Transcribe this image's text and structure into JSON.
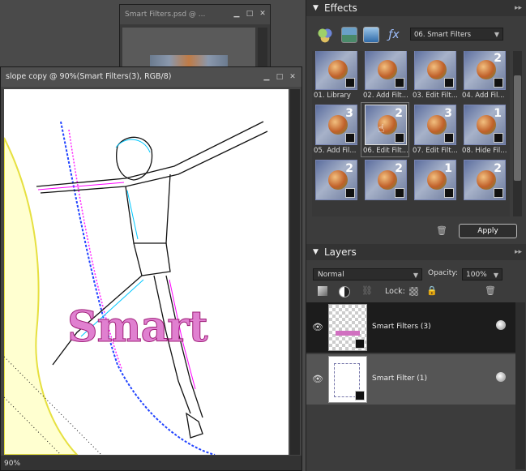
{
  "back_window": {
    "title": "Smart Filters.psd @ ..."
  },
  "doc_window": {
    "title": "slope copy @ 90%(Smart Filters(3), RGB/8)",
    "zoom": "90%",
    "canvas_text": "Smart"
  },
  "effects_panel": {
    "title": "Effects",
    "category_dropdown": "06. Smart Filters",
    "items": [
      {
        "label": "01. Library",
        "num": ""
      },
      {
        "label": "02. Add Filt...",
        "num": ""
      },
      {
        "label": "03. Edit Filt...",
        "num": ""
      },
      {
        "label": "04. Add Fil...",
        "num": "2"
      },
      {
        "label": "05. Add Fil...",
        "num": "3"
      },
      {
        "label": "06. Edit Filt...",
        "num": "2"
      },
      {
        "label": "07. Edit Filt...",
        "num": "3"
      },
      {
        "label": "08. Hide Fil...",
        "num": "1"
      },
      {
        "label": "",
        "num": "2"
      },
      {
        "label": "",
        "num": "2"
      },
      {
        "label": "",
        "num": "1"
      },
      {
        "label": "",
        "num": "2"
      }
    ],
    "selected_index": 5,
    "apply_label": "Apply"
  },
  "layers_panel": {
    "title": "Layers",
    "blend_mode": "Normal",
    "opacity_label": "Opacity:",
    "opacity_value": "100%",
    "lock_label": "Lock:",
    "layers": [
      {
        "name": "Smart Filters (3)",
        "selected": true
      },
      {
        "name": "Smart Filter (1)",
        "selected": false
      }
    ]
  }
}
